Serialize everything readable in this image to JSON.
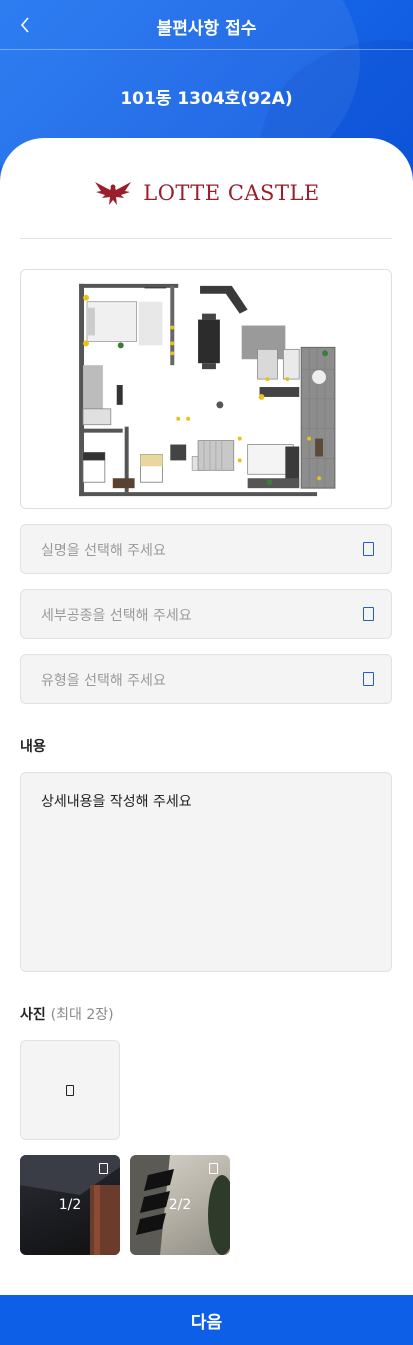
{
  "header": {
    "title": "불편사항 접수",
    "unit": "101동 1304호(92A)"
  },
  "brand": {
    "logo_text": "LOTTE CASTLE",
    "color": "#9b1f2b"
  },
  "form": {
    "name_select": {
      "placeholder": "실명을 선택해 주세요",
      "icon": "chevron-icon"
    },
    "trade_select": {
      "placeholder": "세부공종을 선택해 주세요",
      "icon": "chevron-icon"
    },
    "type_select": {
      "placeholder": "유형을 선택해 주세요",
      "icon": "chevron-icon"
    },
    "content_label": "내용",
    "content_placeholder": "상세내용을 작성해 주세요",
    "photo_label": "사진",
    "photo_hint": "(최대 2장)"
  },
  "photos": [
    {
      "counter": "1/2"
    },
    {
      "counter": "2/2"
    }
  ],
  "footer": {
    "next_label": "다음"
  },
  "colors": {
    "primary": "#0d5fe8",
    "accent_icon": "#1f5fd0"
  }
}
